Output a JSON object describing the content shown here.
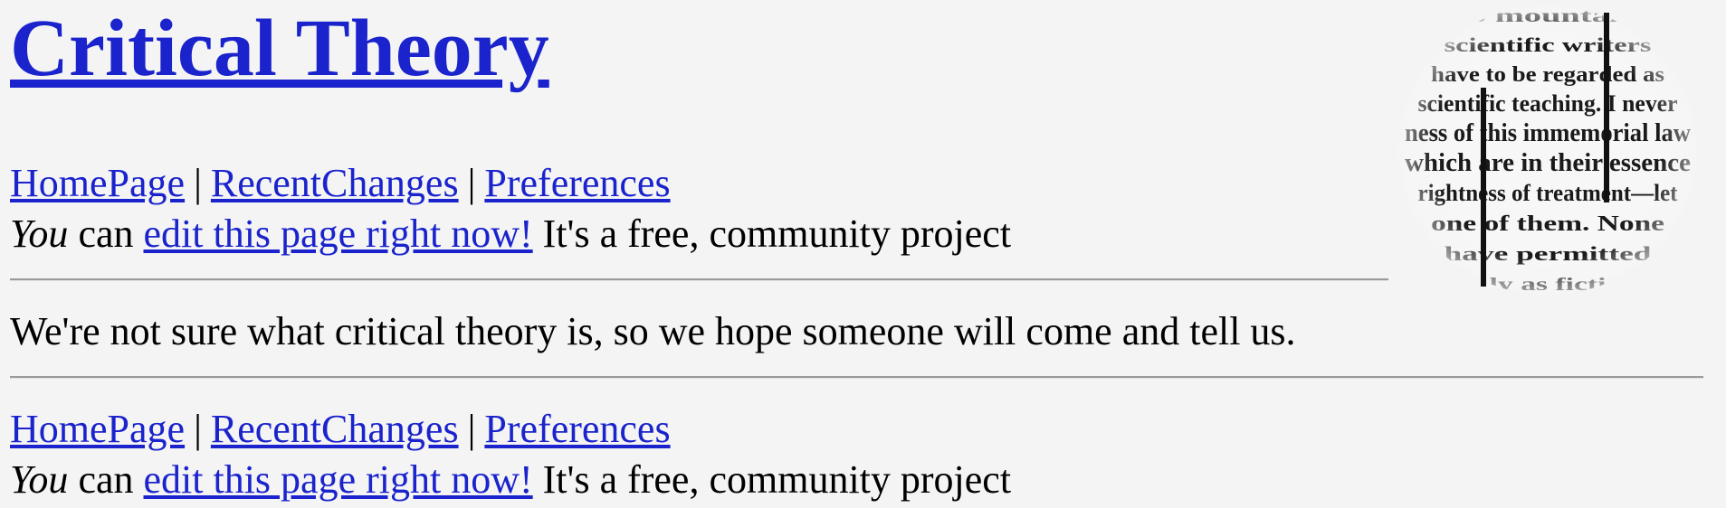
{
  "page": {
    "title": "Critical Theory"
  },
  "nav": {
    "items": [
      "HomePage",
      "RecentChanges",
      "Preferences"
    ],
    "separator": "|"
  },
  "edit_notice": {
    "you": "You",
    "can": "can",
    "link": "edit this page right now!",
    "suffix": "It's a free, community project"
  },
  "content": {
    "text": "We're not sure what critical theory is, so we hope someone will come and tell us."
  },
  "logo": {
    "icon": "newsprint-magnifier-logo",
    "text_lines": [
      "to mountain",
      "scientific writers",
      "have to be regarded as",
      "scientific teaching. I never",
      "ness of this immemorial law",
      "which are in their essence",
      "rightness of treatment—let",
      "one of them. None",
      "have permitted",
      "only as fiction"
    ]
  },
  "colors": {
    "background": "#f4f4f4",
    "link": "#1a23cc",
    "text": "#000000",
    "rule": "#9a9a9a"
  }
}
